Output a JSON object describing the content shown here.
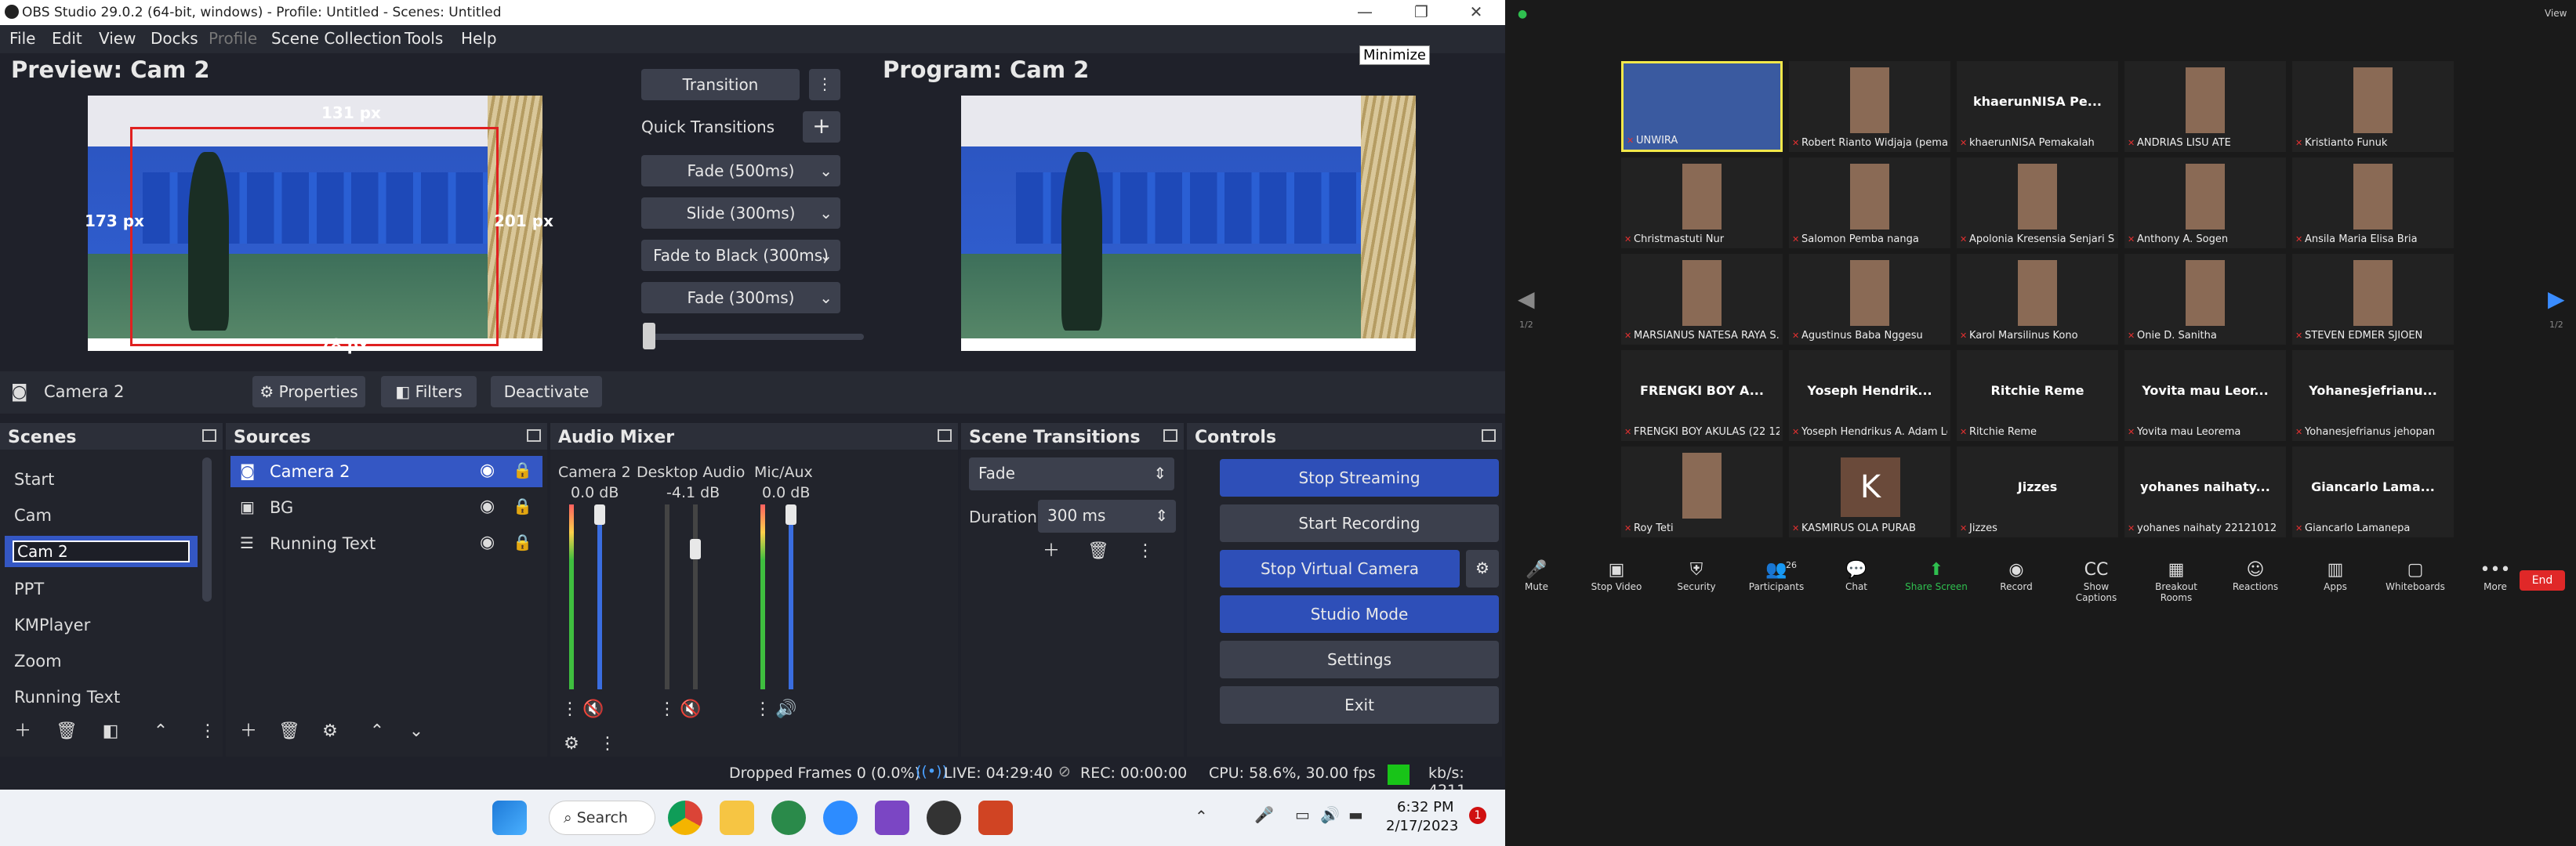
{
  "titlebar": {
    "title": "OBS Studio 29.0.2 (64-bit, windows) - Profile: Untitled - Scenes: Untitled",
    "minimize": "—",
    "maximize": "❐",
    "close": "✕",
    "tooltip": "Minimize"
  },
  "menu": [
    "File",
    "Edit",
    "View",
    "Docks",
    "Profile",
    "Scene Collection",
    "Tools",
    "Help"
  ],
  "preview": {
    "title": "Preview: Cam 2",
    "top_px": "131 px",
    "left_px": "173 px",
    "right_px": "201 px",
    "bottom_px": "78 px"
  },
  "program": {
    "title": "Program: Cam 2"
  },
  "transition": {
    "button": "Transition",
    "quick_label": "Quick Transitions",
    "add": "+",
    "items": [
      "Fade (500ms)",
      "Slide (300ms)",
      "Fade to Black (300ms)",
      "Fade (300ms)"
    ]
  },
  "source_toolbar": {
    "source": "Camera 2",
    "properties": "Properties",
    "filters": "Filters",
    "deactivate": "Deactivate"
  },
  "scenes": {
    "title": "Scenes",
    "items": [
      "Start",
      "Cam",
      "Cam 2",
      "PPT",
      "KMPlayer",
      "Zoom",
      "Running Text"
    ],
    "selected": "Cam 2"
  },
  "sources": {
    "title": "Sources",
    "items": [
      "Camera 2",
      "BG",
      "Running Text"
    ]
  },
  "mixer": {
    "title": "Audio Mixer",
    "channels": [
      {
        "name": "Camera 2",
        "db": "0.0 dB",
        "level": 0.95,
        "muted": true
      },
      {
        "name": "Desktop Audio",
        "db": "-4.1 dB",
        "level": 0.78,
        "muted": true
      },
      {
        "name": "Mic/Aux",
        "db": "0.0 dB",
        "level": 0.95,
        "muted": false
      }
    ],
    "scale": [
      "0",
      "-5",
      "-10",
      "-15",
      "-20",
      "-25",
      "-30",
      "-35",
      "-40",
      "-45",
      "-50",
      "-55",
      "-60"
    ]
  },
  "scene_transitions": {
    "title": "Scene Transitions",
    "type": "Fade",
    "duration_label": "Duration",
    "duration": "300 ms"
  },
  "controls": {
    "title": "Controls",
    "stop_streaming": "Stop Streaming",
    "start_recording": "Start Recording",
    "stop_virtual": "Stop Virtual Camera",
    "studio_mode": "Studio Mode",
    "settings": "Settings",
    "exit": "Exit"
  },
  "status": {
    "dropped": "Dropped Frames 0 (0.0%)",
    "live": "LIVE: 04:29:40",
    "rec": "REC: 00:00:00",
    "cpu": "CPU: 58.6%, 30.00 fps",
    "kbs": "kb/s: 4211"
  },
  "taskbar": {
    "search": "Search",
    "time": "6:32 PM",
    "date": "2/17/2023",
    "notif": "1"
  },
  "zoom": {
    "view": "View",
    "page_left": "1/2",
    "page_right": "1/2",
    "tiles": [
      "UNWIRA",
      "Robert Rianto Widjaja (pema...",
      "khaerunNISA Pemakalah",
      "ANDRIAS LISU ATE",
      "Kristianto Funuk",
      "Christmastuti Nur",
      "Salomon Pemba nanga",
      "Apolonia Kresensia Senjari Sa...",
      "Anthony A. Sogen",
      "Ansila Maria Elisa Bria",
      "MARSIANUS NATESA RAYA S...",
      "Agustinus Baba Nggesu",
      "Karol Marsilinus Kono",
      "Onie D. Sanitha",
      "STEVEN EDMER SJIOEN",
      "FRENGKI BOY AKULAS (22 12 ...",
      "Yoseph Hendrikus A. Adam Le...",
      "Ritchie Reme",
      "Yovita mau Leorema",
      "Yohanesjefrianus jehopan",
      "Roy Teti",
      "KASMIRUS OLA PURAB",
      "Jizzes",
      "yohanes naihaty 22121012",
      "Giancarlo Lamanepa"
    ],
    "big": {
      "2": "khaerunNISA  Pe...",
      "15": "FRENGKI BOY A...",
      "16": "Yoseph  Hendrik...",
      "17": "Ritchie Reme",
      "18": "Yovita mau Leor...",
      "19": "Yohanesjefrianu...",
      "22": "Jizzes",
      "23": "yohanes  naihaty...",
      "24": "Giancarlo  Lama..."
    },
    "k": "K",
    "toolbar": [
      {
        "label": "Mute"
      },
      {
        "label": "Stop Video"
      },
      {
        "label": "Security"
      },
      {
        "label": "Participants",
        "count": "26"
      },
      {
        "label": "Chat"
      },
      {
        "label": "Share Screen"
      },
      {
        "label": "Record"
      },
      {
        "label": "Show Captions"
      },
      {
        "label": "Breakout Rooms"
      },
      {
        "label": "Reactions"
      },
      {
        "label": "Apps"
      },
      {
        "label": "Whiteboards"
      },
      {
        "label": "More"
      }
    ],
    "end": "End"
  }
}
